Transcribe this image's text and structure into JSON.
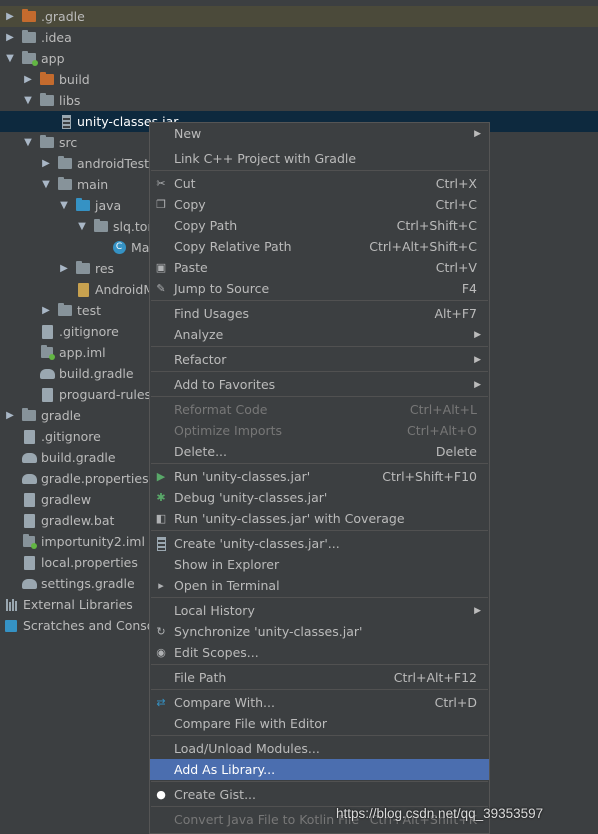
{
  "tree": [
    {
      "label": ".gradle",
      "arrow": "▶",
      "icon": "folder-orange-icon"
    },
    {
      "label": ".idea",
      "arrow": "▶",
      "icon": "folder-icon"
    },
    {
      "label": "app",
      "arrow": "▼",
      "icon": "module-folder-icon"
    },
    {
      "label": "build",
      "arrow": "▶",
      "icon": "folder-orange-icon"
    },
    {
      "label": "libs",
      "arrow": "▼",
      "icon": "folder-icon"
    },
    {
      "label": "unity-classes.jar",
      "arrow": "",
      "icon": "jar-icon"
    },
    {
      "label": "src",
      "arrow": "▼",
      "icon": "folder-icon"
    },
    {
      "label": "androidTest",
      "arrow": "▶",
      "icon": "folder-icon"
    },
    {
      "label": "main",
      "arrow": "▼",
      "icon": "folder-icon"
    },
    {
      "label": "java",
      "arrow": "▼",
      "icon": "source-folder-icon"
    },
    {
      "label": "slq.tor",
      "arrow": "▼",
      "icon": "package-icon"
    },
    {
      "label": "Ma",
      "arrow": "",
      "icon": "class-icon"
    },
    {
      "label": "res",
      "arrow": "▶",
      "icon": "folder-icon"
    },
    {
      "label": "AndroidM",
      "arrow": "",
      "icon": "manifest-icon"
    },
    {
      "label": "test",
      "arrow": "▶",
      "icon": "folder-icon"
    },
    {
      "label": ".gitignore",
      "arrow": "",
      "icon": "file-icon"
    },
    {
      "label": "app.iml",
      "arrow": "",
      "icon": "iml-file-icon"
    },
    {
      "label": "build.gradle",
      "arrow": "",
      "icon": "gradle-icon"
    },
    {
      "label": "proguard-rules",
      "arrow": "",
      "icon": "file-icon"
    },
    {
      "label": "gradle",
      "arrow": "▶",
      "icon": "folder-icon"
    },
    {
      "label": ".gitignore",
      "arrow": "",
      "icon": "file-icon"
    },
    {
      "label": "build.gradle",
      "arrow": "",
      "icon": "gradle-icon"
    },
    {
      "label": "gradle.properties",
      "arrow": "",
      "icon": "gradle-icon"
    },
    {
      "label": "gradlew",
      "arrow": "",
      "icon": "file-icon"
    },
    {
      "label": "gradlew.bat",
      "arrow": "",
      "icon": "file-icon"
    },
    {
      "label": "importunity2.iml",
      "arrow": "",
      "icon": "iml-file-icon"
    },
    {
      "label": "local.properties",
      "arrow": "",
      "icon": "file-icon"
    },
    {
      "label": "settings.gradle",
      "arrow": "",
      "icon": "gradle-icon"
    },
    {
      "label": "External Libraries",
      "arrow": "▶",
      "icon": "libraries-icon"
    },
    {
      "label": "Scratches and Console",
      "arrow": "▶",
      "icon": "scratches-icon"
    }
  ],
  "menu": [
    {
      "label": "New",
      "shortcut": "",
      "submenu": true,
      "icon": ""
    },
    {
      "label": "Link C++ Project with Gradle",
      "shortcut": "",
      "icon": ""
    },
    {
      "label": "Cut",
      "shortcut": "Ctrl+X",
      "icon": "scissors-icon"
    },
    {
      "label": "Copy",
      "shortcut": "Ctrl+C",
      "icon": "copy-icon"
    },
    {
      "label": "Copy Path",
      "shortcut": "Ctrl+Shift+C",
      "icon": ""
    },
    {
      "label": "Copy Relative Path",
      "shortcut": "Ctrl+Alt+Shift+C",
      "icon": ""
    },
    {
      "label": "Paste",
      "shortcut": "Ctrl+V",
      "icon": "clipboard-icon"
    },
    {
      "label": "Jump to Source",
      "shortcut": "F4",
      "icon": "pencil-icon"
    },
    {
      "label": "Find Usages",
      "shortcut": "Alt+F7",
      "icon": ""
    },
    {
      "label": "Analyze",
      "shortcut": "",
      "submenu": true,
      "icon": ""
    },
    {
      "label": "Refactor",
      "shortcut": "",
      "submenu": true,
      "icon": ""
    },
    {
      "label": "Add to Favorites",
      "shortcut": "",
      "submenu": true,
      "icon": ""
    },
    {
      "label": "Reformat Code",
      "shortcut": "Ctrl+Alt+L",
      "disabled": true,
      "icon": ""
    },
    {
      "label": "Optimize Imports",
      "shortcut": "Ctrl+Alt+O",
      "disabled": true,
      "icon": ""
    },
    {
      "label": "Delete...",
      "shortcut": "Delete",
      "icon": ""
    },
    {
      "label": "Run 'unity-classes.jar'",
      "shortcut": "Ctrl+Shift+F10",
      "icon": "run-icon"
    },
    {
      "label": "Debug 'unity-classes.jar'",
      "shortcut": "",
      "icon": "bug-icon"
    },
    {
      "label": "Run 'unity-classes.jar' with Coverage",
      "shortcut": "",
      "icon": "coverage-icon"
    },
    {
      "label": "Create 'unity-classes.jar'...",
      "shortcut": "",
      "icon": "jar-icon"
    },
    {
      "label": "Show in Explorer",
      "shortcut": "",
      "icon": ""
    },
    {
      "label": "Open in Terminal",
      "shortcut": "",
      "icon": "terminal-icon"
    },
    {
      "label": "Local History",
      "shortcut": "",
      "submenu": true,
      "icon": ""
    },
    {
      "label": "Synchronize 'unity-classes.jar'",
      "shortcut": "",
      "icon": "sync-icon"
    },
    {
      "label": "Edit Scopes...",
      "shortcut": "",
      "icon": "scope-icon"
    },
    {
      "label": "File Path",
      "shortcut": "Ctrl+Alt+F12",
      "icon": ""
    },
    {
      "label": "Compare With...",
      "shortcut": "Ctrl+D",
      "icon": "compare-icon"
    },
    {
      "label": "Compare File with Editor",
      "shortcut": "",
      "icon": ""
    },
    {
      "label": "Load/Unload Modules...",
      "shortcut": "",
      "icon": ""
    },
    {
      "label": "Add As Library...",
      "shortcut": "",
      "active": true,
      "icon": ""
    },
    {
      "label": "Create Gist...",
      "shortcut": "",
      "icon": "github-icon"
    },
    {
      "label": "Convert Java File to Kotlin File",
      "shortcut": "Ctrl+Alt+Shift+K",
      "disabled": true,
      "icon": ""
    }
  ],
  "watermark": "https://blog.csdn.net/qq_39353597"
}
